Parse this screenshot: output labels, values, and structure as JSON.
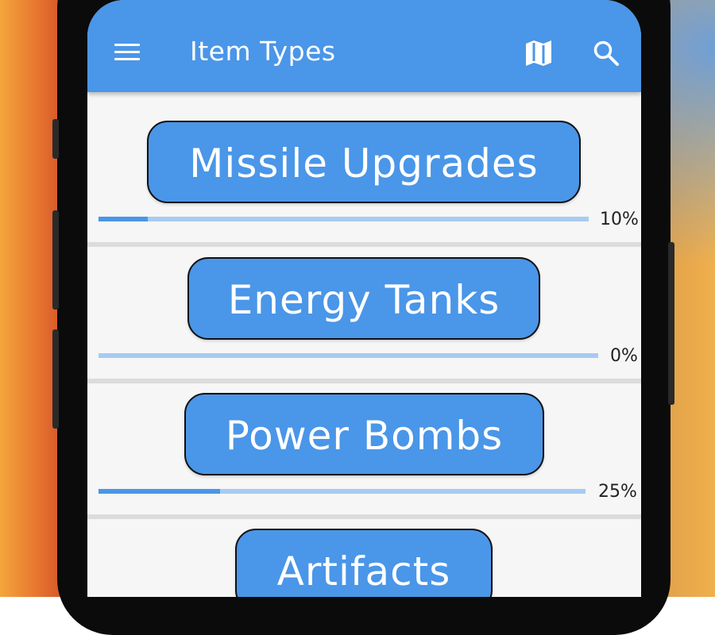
{
  "appbar": {
    "title": "Item Types",
    "menu_icon": "menu-icon",
    "map_icon": "map-icon",
    "search_icon": "search-icon"
  },
  "colors": {
    "primary": "#4a96e8",
    "track": "#a7cbf2"
  },
  "items": [
    {
      "label": "Missile Upgrades",
      "progress_text": "10%",
      "progress": 0.1
    },
    {
      "label": "Energy Tanks",
      "progress_text": "0%",
      "progress": 0.0
    },
    {
      "label": "Power Bombs",
      "progress_text": "25%",
      "progress": 0.25
    },
    {
      "label": "Artifacts",
      "progress_text": "",
      "progress": null
    }
  ]
}
